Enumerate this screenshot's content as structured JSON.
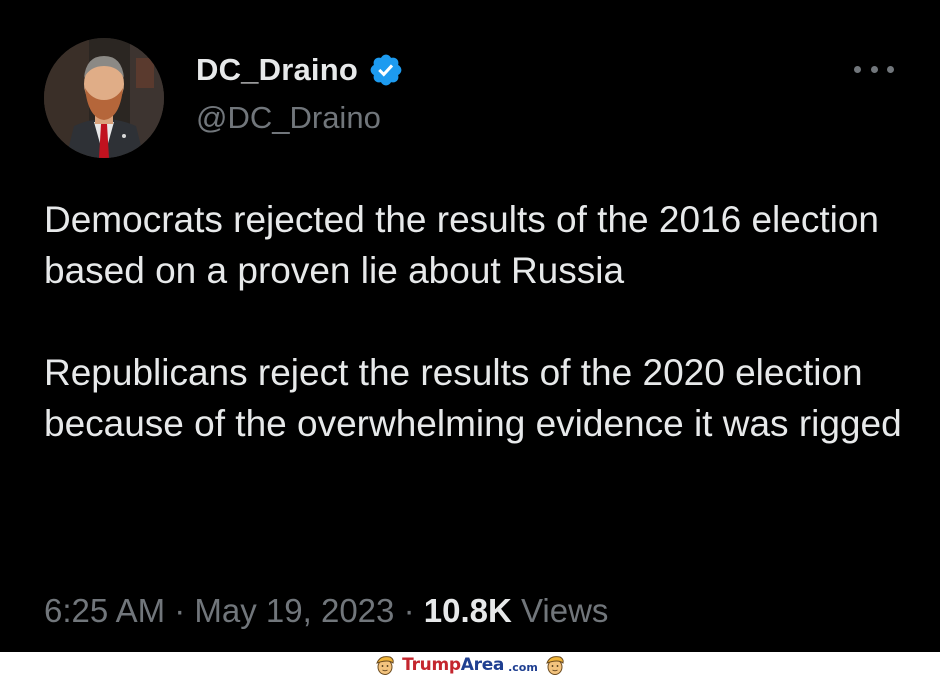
{
  "author": {
    "display_name": "DC_Draino",
    "handle": "@DC_Draino",
    "verified": true
  },
  "tweet": {
    "paragraphs": [
      "Democrats rejected the results of the 2016 election based on a proven lie about Russia",
      "Republicans reject the results of the 2020 election because of the overwhelming evidence it was rigged"
    ],
    "time": "6:25 AM",
    "date": "May 19, 2023",
    "views_count": "10.8K",
    "views_label": "Views",
    "separator": "·"
  },
  "watermark": {
    "brand_red": "Trump",
    "brand_blue": "Area",
    "suffix": ".com"
  },
  "icons": {
    "verified": "verified-badge-icon",
    "more": "more-options-icon"
  },
  "colors": {
    "background": "#000000",
    "text": "#e7e9ea",
    "secondary_text": "#71767b",
    "verified_badge": "#1d9bf0",
    "watermark_red": "#c4262e",
    "watermark_blue": "#1f3f91"
  }
}
